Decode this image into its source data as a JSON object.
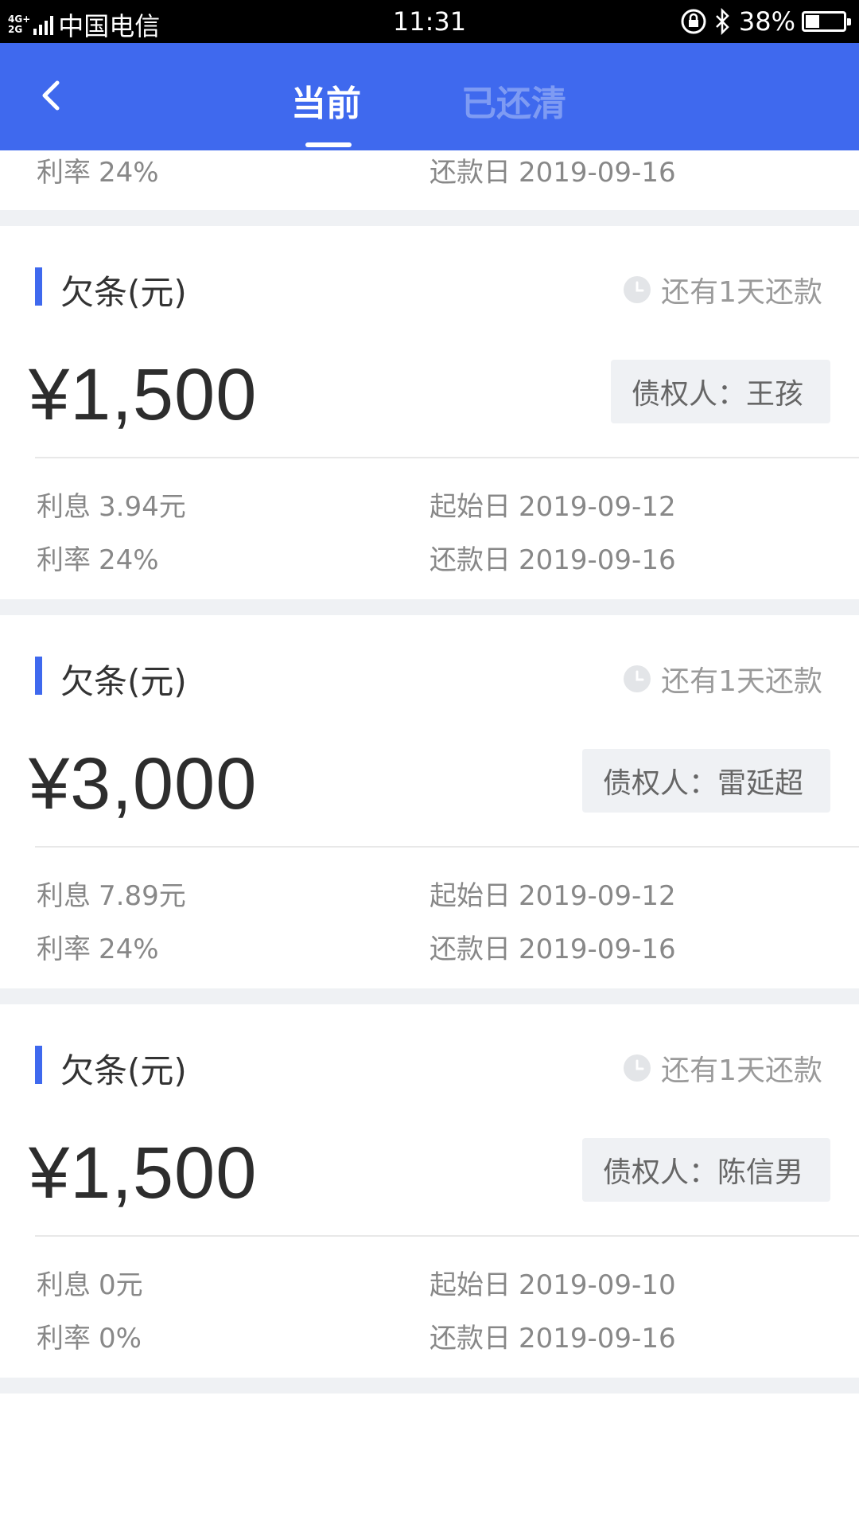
{
  "status_bar": {
    "network": "4G+ 2G",
    "carrier": "中国电信",
    "time": "11:31",
    "battery": "38%",
    "battery_level": 0.38
  },
  "nav": {
    "tabs": [
      {
        "label": "当前",
        "active": true
      },
      {
        "label": "已还清",
        "active": false
      }
    ]
  },
  "partial_card": {
    "rate_label": "利率",
    "rate": "24%",
    "due_label": "还款日",
    "due": "2019-09-16"
  },
  "cards": [
    {
      "title": "欠条(元)",
      "countdown": "还有1天还款",
      "amount": "¥1,500",
      "creditor": "债权人：王孩",
      "interest_label": "利息",
      "interest": "3.94元",
      "start_label": "起始日",
      "start": "2019-09-12",
      "rate_label": "利率",
      "rate": "24%",
      "due_label": "还款日",
      "due": "2019-09-16"
    },
    {
      "title": "欠条(元)",
      "countdown": "还有1天还款",
      "amount": "¥3,000",
      "creditor": "债权人：雷延超",
      "interest_label": "利息",
      "interest": "7.89元",
      "start_label": "起始日",
      "start": "2019-09-12",
      "rate_label": "利率",
      "rate": "24%",
      "due_label": "还款日",
      "due": "2019-09-16"
    },
    {
      "title": "欠条(元)",
      "countdown": "还有1天还款",
      "amount": "¥1,500",
      "creditor": "债权人：陈信男",
      "interest_label": "利息",
      "interest": "0元",
      "start_label": "起始日",
      "start": "2019-09-10",
      "rate_label": "利率",
      "rate": "0%",
      "due_label": "还款日",
      "due": "2019-09-16"
    }
  ],
  "colors": {
    "primary": "#3f69ee",
    "inactive_tab": "#7e9bf3",
    "page_gap": "#eff1f4",
    "muted_text": "#888888"
  }
}
